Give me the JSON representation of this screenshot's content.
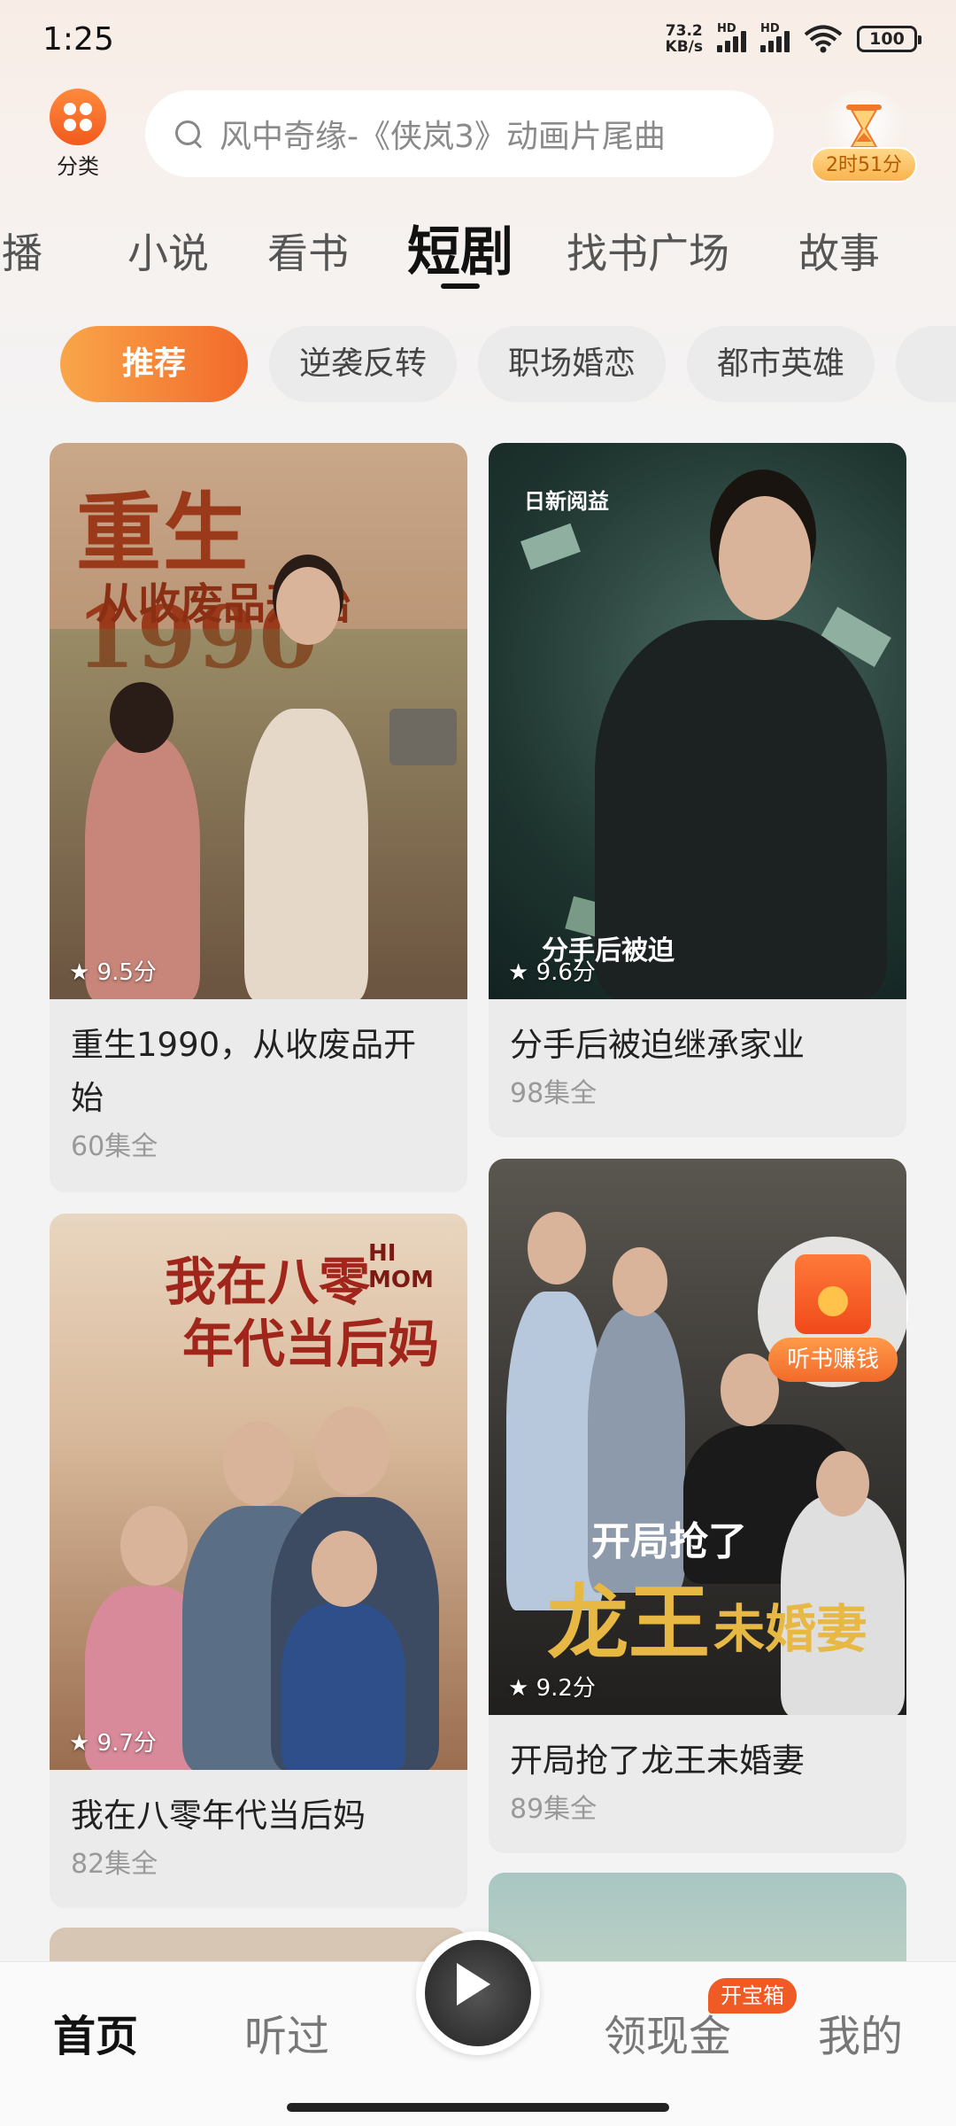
{
  "status_bar": {
    "time": "1:25",
    "net_speed_value": "73.2",
    "net_speed_unit": "KB/s",
    "signal_label": "HD",
    "battery": "100"
  },
  "header": {
    "category_label": "分类",
    "search_placeholder": "风中奇缘-《侠岚3》动画片尾曲",
    "timer_label": "2时51分"
  },
  "tabs": [
    {
      "label": "广播"
    },
    {
      "label": "小说"
    },
    {
      "label": "看书"
    },
    {
      "label": "短剧",
      "active": true
    },
    {
      "label": "找书广场"
    },
    {
      "label": "故事"
    }
  ],
  "chips": [
    {
      "label": "推荐",
      "active": true
    },
    {
      "label": "逆袭反转"
    },
    {
      "label": "职场婚恋"
    },
    {
      "label": "都市英雄"
    }
  ],
  "cards": [
    {
      "poster_title": "重生1990",
      "poster_subtitle": "从收废品开始",
      "rating": "9.5分",
      "title": "重生1990，从收废品开始",
      "episodes": "60集全"
    },
    {
      "poster_logo": "日新阅益",
      "poster_caption": "分手后被迫",
      "rating": "9.6分",
      "title": "分手后被迫继承家业",
      "episodes": "98集全"
    },
    {
      "poster_title_1": "我在八零",
      "poster_title_2": "年代当后妈",
      "poster_en": "HI MOM",
      "rating": "9.7分",
      "title": "我在八零年代当后妈",
      "episodes": "82集全"
    },
    {
      "poster_title_1": "开局抢了",
      "poster_title_2": "龙王",
      "poster_title_3": "未婚妻",
      "rating": "9.2分",
      "title": "开局抢了龙王未婚妻",
      "episodes": "89集全"
    }
  ],
  "promo": {
    "label": "听书赚钱"
  },
  "bottom_nav": {
    "home": "首页",
    "history": "听过",
    "cash": "领现金",
    "cash_badge": "开宝箱",
    "mine": "我的"
  },
  "colors": {
    "accent": "#f26a2a",
    "chip_active_start": "#f9a64a",
    "badge": "#f05a24"
  }
}
